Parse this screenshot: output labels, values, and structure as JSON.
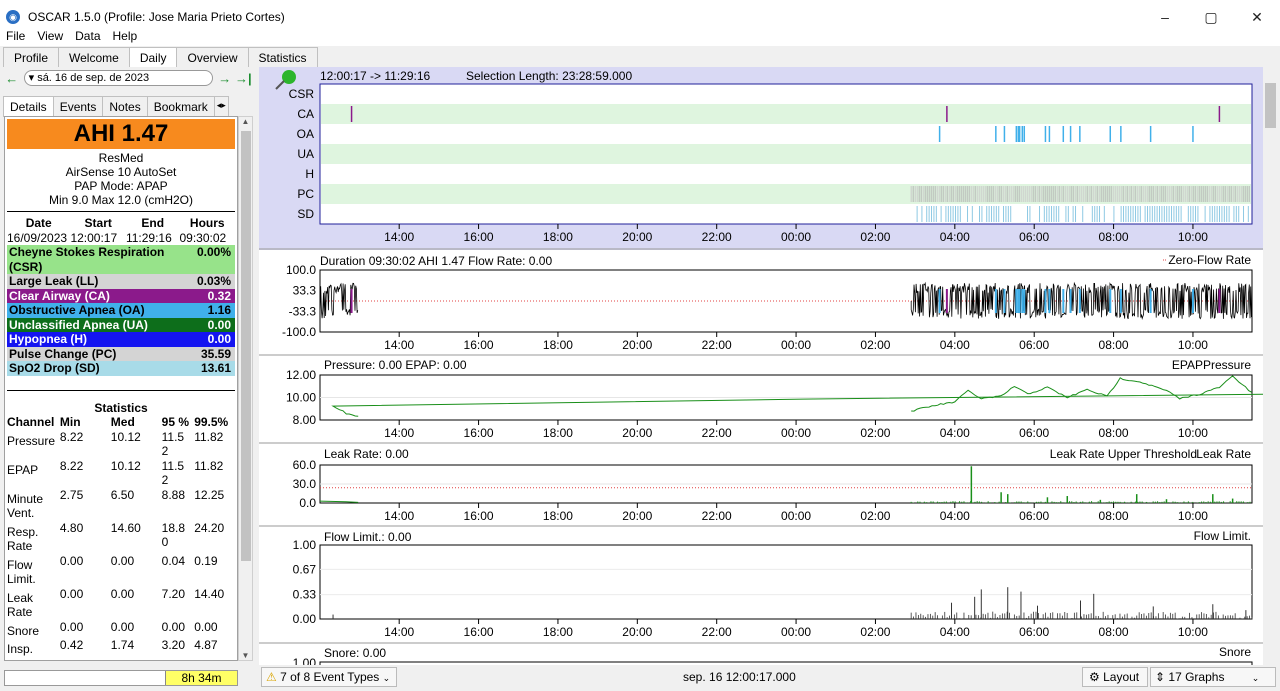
{
  "window": {
    "title": "OSCAR 1.5.0 (Profile: Jose Maria Prieto Cortes)",
    "min": "–",
    "max": "▢",
    "close": "✕"
  },
  "menu": [
    "File",
    "View",
    "Data",
    "Help"
  ],
  "tabs": [
    "Profile",
    "Welcome",
    "Daily",
    "Overview",
    "Statistics"
  ],
  "date": {
    "value": "sá. 16 de sep. de 2023",
    "prev": "←",
    "next": "→",
    "last": "→|"
  },
  "subtabs": [
    "Details",
    "Events",
    "Notes",
    "Bookmark"
  ],
  "summary": {
    "ahi": "AHI  1.47",
    "device": [
      "ResMed",
      "AirSense 10 AutoSet",
      "PAP Mode: APAP",
      "Min 9.0 Max 12.0 (cmH2O)"
    ],
    "session_headers": [
      "Date",
      "Start",
      "End",
      "Hours"
    ],
    "session_values": [
      "16/09/2023",
      "12:00:17",
      "11:29:16",
      "09:30:02"
    ]
  },
  "events": [
    {
      "label": "Cheyne Stokes Respiration (CSR)",
      "value": "0.00%",
      "bg": "#97e38a",
      "fg": "#000"
    },
    {
      "label": "Large Leak (LL)",
      "value": "0.03%",
      "bg": "#d4d4d4",
      "fg": "#000"
    },
    {
      "label": "Clear Airway (CA)",
      "value": "0.32",
      "bg": "#8b1a8b",
      "fg": "#fff"
    },
    {
      "label": "Obstructive Apnea (OA)",
      "value": "1.16",
      "bg": "#40b0ea",
      "fg": "#000"
    },
    {
      "label": "Unclassified Apnea (UA)",
      "value": "0.00",
      "bg": "#0d6e1b",
      "fg": "#fff"
    },
    {
      "label": "Hypopnea (H)",
      "value": "0.00",
      "bg": "#1414f0",
      "fg": "#fff"
    },
    {
      "label": "Pulse Change (PC)",
      "value": "35.59",
      "bg": "#d4d4d4",
      "fg": "#000"
    },
    {
      "label": "SpO2 Drop (SD)",
      "value": "13.61",
      "bg": "#a8dbe8",
      "fg": "#000"
    }
  ],
  "stats": {
    "title": "Statistics",
    "headers": [
      "Channel",
      "Min",
      "Med",
      "95 %",
      "99.5%"
    ],
    "rows": [
      [
        "Pressure",
        "8.22",
        "10.12",
        "11.52",
        "11.82"
      ],
      [
        "EPAP",
        "8.22",
        "10.12",
        "11.52",
        "11.82"
      ],
      [
        "Minute Vent.",
        "2.75",
        "6.50",
        "8.88",
        "12.25"
      ],
      [
        "Resp. Rate",
        "4.80",
        "14.60",
        "18.80",
        "24.20"
      ],
      [
        "Flow Limit.",
        "0.00",
        "0.00",
        "0.04",
        "0.19"
      ],
      [
        "Leak Rate",
        "0.00",
        "0.00",
        "7.20",
        "14.40"
      ],
      [
        "Snore",
        "0.00",
        "0.00",
        "0.00",
        "0.00"
      ],
      [
        "Insp.",
        "0.42",
        "1.74",
        "3.20",
        "4.87"
      ]
    ]
  },
  "bottom": {
    "duration_badge": "8h 34m",
    "event_types": "7 of 8 Event Types",
    "timestamp": "sep. 16 12:00:17.000",
    "layout": "Layout",
    "graphs": "17 Graphs"
  },
  "graph_header": {
    "range": "12:00:17 -> 11:29:16",
    "selection": "Selection Length: 23:28:59.000"
  },
  "chart_data": [
    {
      "type": "scatter",
      "title": "Event Flags",
      "ylabel": "Event Flags",
      "categories": [
        "CSR",
        "CA",
        "OA",
        "UA",
        "H",
        "PC",
        "SD"
      ],
      "x_ticks": [
        "14:00",
        "16:00",
        "18:00",
        "20:00",
        "22:00",
        "00:00",
        "02:00",
        "04:00",
        "06:00",
        "08:00",
        "10:00"
      ],
      "x_range": [
        "12:00:17",
        "11:29:16"
      ],
      "events": {
        "CA": [
          "12:48",
          "03:48",
          "10:40"
        ],
        "OA": [
          "03:37",
          "05:02",
          "05:15",
          "05:33",
          "05:36",
          "05:38",
          "05:42",
          "05:45",
          "06:17",
          "06:23",
          "06:44",
          "06:55",
          "07:09",
          "07:55",
          "08:11",
          "08:56",
          "10:00"
        ],
        "PC_range": [
          "02:54",
          "11:25"
        ],
        "SD_range": [
          "03:03",
          "11:25"
        ]
      }
    },
    {
      "type": "line",
      "title": "Duration 09:30:02 AHI 1.47 Flow Rate: 0.00",
      "ylabel": "Flow Rate",
      "y_ticks": [
        "100.0",
        "33.3",
        "-33.3",
        "-100.0"
      ],
      "ylim": [
        -100,
        100
      ],
      "legend": [
        "Zero-Flow Rate"
      ],
      "x_ticks": [
        "14:00",
        "16:00",
        "18:00",
        "20:00",
        "22:00",
        "00:00",
        "02:00",
        "04:00",
        "06:00",
        "08:00",
        "10:00"
      ],
      "segments": [
        [
          "12:00:17",
          "12:58"
        ],
        [
          "02:54",
          "11:29:16"
        ]
      ]
    },
    {
      "type": "line",
      "title": "Pressure: 0.00 EPAP: 0.00",
      "ylabel": "Pressure",
      "y_ticks": [
        "12.00",
        "10.00",
        "8.00"
      ],
      "ylim": [
        8,
        12
      ],
      "legend": [
        "EPAP",
        "Pressure"
      ],
      "x_ticks": [
        "14:00",
        "16:00",
        "18:00",
        "20:00",
        "22:00",
        "00:00",
        "02:00",
        "04:00",
        "06:00",
        "08:00",
        "10:00"
      ],
      "series": [
        {
          "x": [
            "12:00",
            "12:20",
            "12:40",
            "12:58"
          ],
          "y": [
            10.3,
            9.3,
            8.6,
            8.3
          ]
        },
        {
          "x": [
            "02:54",
            "03:30",
            "04:00",
            "04:20",
            "04:40",
            "05:10",
            "05:30",
            "05:50",
            "06:20",
            "06:50",
            "07:20",
            "07:50",
            "08:10",
            "08:40",
            "09:20",
            "09:40",
            "10:10",
            "10:40",
            "11:00",
            "11:29"
          ],
          "y": [
            8.8,
            9.3,
            9.6,
            10.6,
            9.9,
            10.1,
            11.0,
            10.3,
            10.9,
            10.0,
            10.7,
            10.1,
            11.7,
            11.4,
            10.6,
            9.9,
            10.3,
            10.9,
            11.9,
            10.4
          ]
        }
      ]
    },
    {
      "type": "bar",
      "title": "Leak Rate: 0.00",
      "ylabel": "Leak Rate",
      "y_ticks": [
        "60.0",
        "30.0",
        "0.0"
      ],
      "ylim": [
        0,
        60
      ],
      "legend": [
        "Leak Rate Upper Threshold",
        "Leak Rate"
      ],
      "threshold": 24,
      "x_ticks": [
        "14:00",
        "16:00",
        "18:00",
        "20:00",
        "22:00",
        "00:00",
        "02:00",
        "04:00",
        "06:00",
        "08:00",
        "10:00"
      ],
      "spikes": [
        [
          "04:25",
          58
        ],
        [
          "05:10",
          17
        ],
        [
          "05:20",
          14
        ],
        [
          "06:20",
          9
        ],
        [
          "06:50",
          11
        ],
        [
          "07:40",
          5
        ],
        [
          "08:35",
          14
        ],
        [
          "09:20",
          6
        ],
        [
          "10:30",
          14
        ],
        [
          "11:00",
          7
        ]
      ]
    },
    {
      "type": "bar",
      "title": "Flow Limit.: 0.00",
      "ylabel": "Flow Limit.",
      "y_ticks": [
        "1.00",
        "0.67",
        "0.33",
        "0.00"
      ],
      "ylim": [
        0,
        1
      ],
      "legend": [
        "Flow Limit."
      ],
      "x_ticks": [
        "14:00",
        "16:00",
        "18:00",
        "20:00",
        "22:00",
        "00:00",
        "02:00",
        "04:00",
        "06:00",
        "08:00",
        "10:00"
      ],
      "spikes": [
        [
          "12:20",
          0.06
        ],
        [
          "03:55",
          0.22
        ],
        [
          "04:30",
          0.3
        ],
        [
          "04:40",
          0.4
        ],
        [
          "05:20",
          0.43
        ],
        [
          "05:40",
          0.37
        ],
        [
          "06:05",
          0.18
        ],
        [
          "07:10",
          0.25
        ],
        [
          "07:30",
          0.34
        ],
        [
          "09:00",
          0.17
        ],
        [
          "10:30",
          0.2
        ],
        [
          "11:20",
          0.12
        ]
      ]
    },
    {
      "type": "line",
      "title": "Snore: 0.00",
      "ylabel": "",
      "y_ticks": [
        "1.00"
      ],
      "legend": [
        "Snore"
      ]
    }
  ]
}
